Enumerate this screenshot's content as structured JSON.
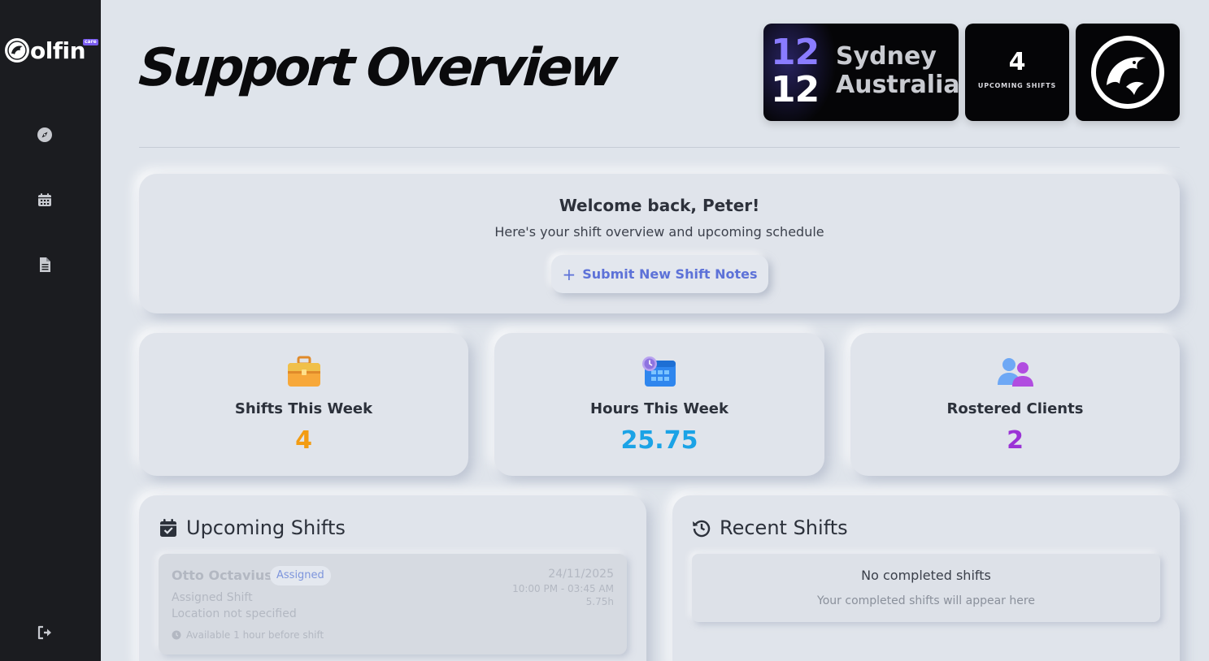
{
  "brand": {
    "name": "olfin",
    "badge": "care"
  },
  "sidebar": {
    "items": [
      {
        "icon": "compass-icon"
      },
      {
        "icon": "calendar-icon"
      },
      {
        "icon": "document-icon"
      }
    ],
    "logout_icon": "logout-icon"
  },
  "header": {
    "title": "Support Overview",
    "clock": {
      "hour": "12",
      "minute": "12",
      "city": "Sydney",
      "country": "Australia",
      "hour_color": "#8a7cff"
    },
    "upcoming": {
      "count": "4",
      "label": "UPCOMING SHIFTS"
    }
  },
  "welcome": {
    "title": "Welcome back, Peter!",
    "subtitle": "Here's your shift overview and upcoming schedule",
    "button_label": "Submit New Shift Notes",
    "button_icon": "plus-icon"
  },
  "stats": [
    {
      "label": "Shifts This Week",
      "value": "4",
      "color": "#f39c12",
      "icon": "briefcase-icon"
    },
    {
      "label": "Hours This Week",
      "value": "25.75",
      "color": "#1ba3e6",
      "icon": "calendar-clock-icon"
    },
    {
      "label": "Rostered Clients",
      "value": "2",
      "color": "#9b33d6",
      "icon": "users-icon"
    }
  ],
  "upcoming": {
    "title": "Upcoming Shifts",
    "shifts": [
      {
        "client": "Otto Octavius",
        "status": "Assigned",
        "type": "Assigned Shift",
        "location": "Location not specified",
        "note": "Available 1 hour before shift",
        "date": "24/11/2025",
        "time": "10:00 PM - 03:45 AM",
        "hours": "5.75h"
      }
    ]
  },
  "recent": {
    "title": "Recent Shifts",
    "empty_title": "No completed shifts",
    "empty_subtitle": "Your completed shifts will appear here"
  }
}
